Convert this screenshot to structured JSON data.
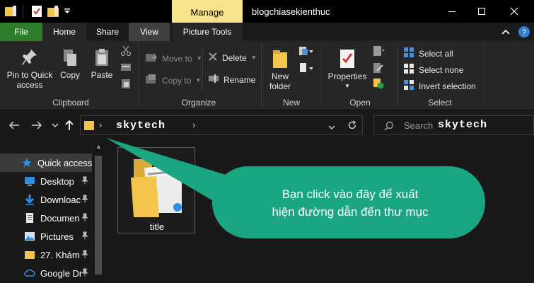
{
  "titlebar": {
    "contextual_tab": "Manage",
    "window_title": "blogchiasekienthuc"
  },
  "tabs": {
    "file": "File",
    "home": "Home",
    "share": "Share",
    "view": "View",
    "picture_tools": "Picture Tools"
  },
  "ribbon": {
    "clipboard": {
      "label": "Clipboard",
      "pin_line1": "Pin to Quick",
      "pin_line2": "access",
      "copy": "Copy",
      "paste": "Paste"
    },
    "organize": {
      "label": "Organize",
      "move_to": "Move to",
      "copy_to": "Copy to",
      "delete": "Delete",
      "rename": "Rename"
    },
    "new": {
      "label": "New",
      "new_folder_line1": "New",
      "new_folder_line2": "folder"
    },
    "open": {
      "label": "Open",
      "properties": "Properties"
    },
    "select": {
      "label": "Select",
      "select_all": "Select all",
      "select_none": "Select none",
      "invert": "Invert selection"
    }
  },
  "address": {
    "location": "skytech"
  },
  "search": {
    "placeholder": "Search",
    "location": "skytech"
  },
  "sidebar": {
    "items": [
      {
        "label": "Quick access"
      },
      {
        "label": "Desktop"
      },
      {
        "label": "Downloac"
      },
      {
        "label": "Documen"
      },
      {
        "label": "Pictures"
      },
      {
        "label": "27. Khám"
      },
      {
        "label": "Google Dr"
      }
    ]
  },
  "content": {
    "items": [
      {
        "label": "title"
      }
    ]
  },
  "callout": {
    "line1": "Bạn click vào đây để xuất",
    "line2": "hiện đường dẫn đến thư mục",
    "color": "#1aa683"
  },
  "colors": {
    "file_tab": "#2d7d2d",
    "manage_tab": "#f6e38b",
    "folder": "#f3c64b"
  }
}
